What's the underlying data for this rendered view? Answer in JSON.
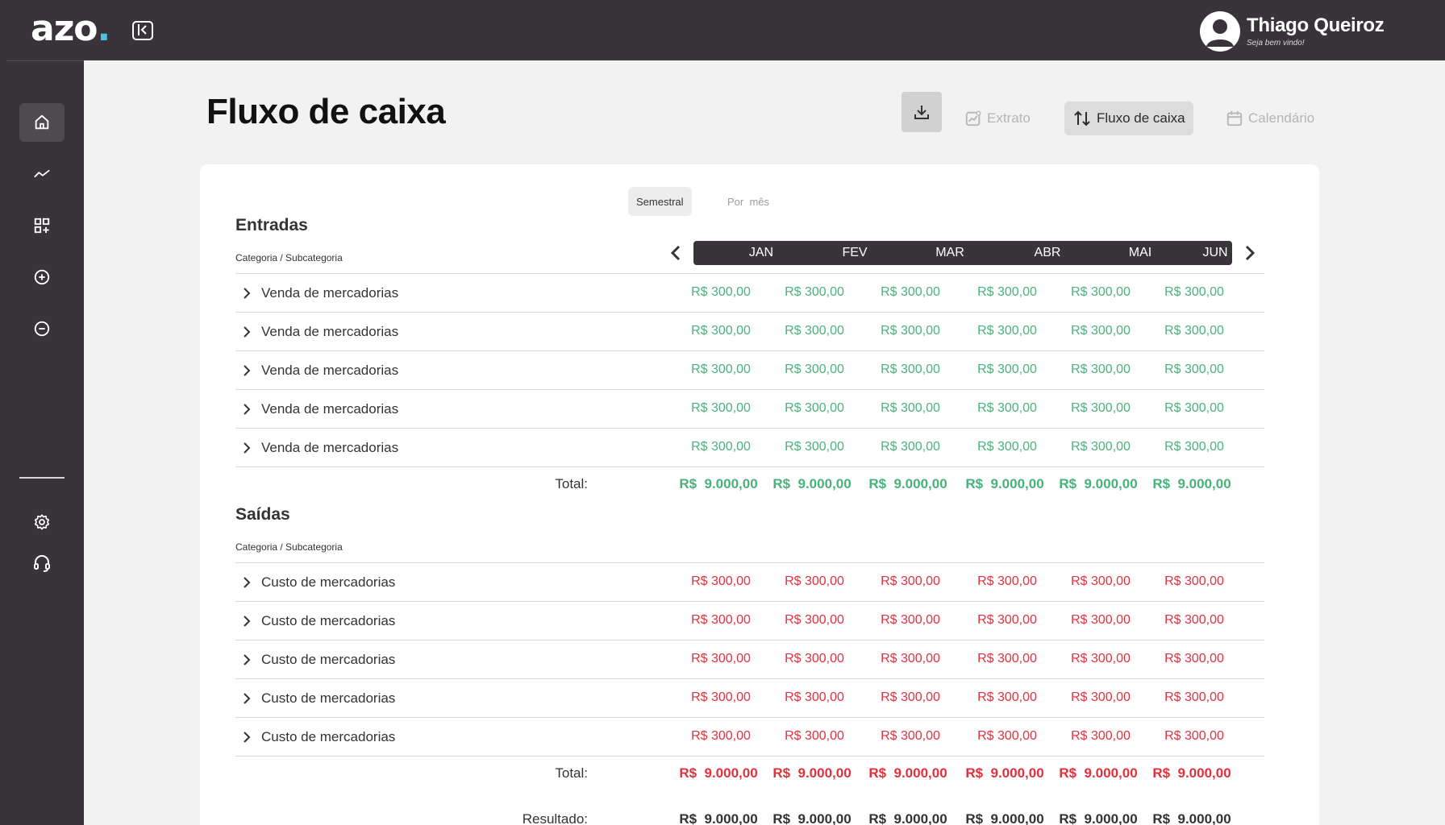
{
  "app": {
    "logo_text": "azo",
    "logo_dot": ".",
    "accent": "#4cc3e6"
  },
  "user": {
    "name": "Thiago Queiroz",
    "greeting": "Seja bem vindo!"
  },
  "page": {
    "title": "Fluxo de caixa"
  },
  "tabs": [
    {
      "label": "Extrato",
      "active": false
    },
    {
      "label": "Fluxo de caixa",
      "active": true
    },
    {
      "label": "Calendário",
      "active": false
    }
  ],
  "view_toggle": {
    "semestral": "Semestral",
    "por_mes": "Por  mês",
    "selected": "Semestral"
  },
  "months": [
    "JAN",
    "FEV",
    "MAR",
    "ABR",
    "MAI",
    "JUN"
  ],
  "entradas": {
    "title": "Entradas",
    "column_header": "Categoria / Subcategoria",
    "rows": [
      {
        "label": "Venda de mercadorias",
        "values": [
          "R$ 300,00",
          "R$ 300,00",
          "R$ 300,00",
          "R$ 300,00",
          "R$ 300,00",
          "R$ 300,00"
        ]
      },
      {
        "label": "Venda de mercadorias",
        "values": [
          "R$ 300,00",
          "R$ 300,00",
          "R$ 300,00",
          "R$ 300,00",
          "R$ 300,00",
          "R$ 300,00"
        ]
      },
      {
        "label": "Venda de mercadorias",
        "values": [
          "R$ 300,00",
          "R$ 300,00",
          "R$ 300,00",
          "R$ 300,00",
          "R$ 300,00",
          "R$ 300,00"
        ]
      },
      {
        "label": "Venda de mercadorias",
        "values": [
          "R$ 300,00",
          "R$ 300,00",
          "R$ 300,00",
          "R$ 300,00",
          "R$ 300,00",
          "R$ 300,00"
        ]
      },
      {
        "label": "Venda de mercadorias",
        "values": [
          "R$ 300,00",
          "R$ 300,00",
          "R$ 300,00",
          "R$ 300,00",
          "R$ 300,00",
          "R$ 300,00"
        ]
      }
    ],
    "total_label": "Total:",
    "totals": [
      "R$  9.000,00",
      "R$  9.000,00",
      "R$  9.000,00",
      "R$  9.000,00",
      "R$  9.000,00",
      "R$  9.000,00"
    ]
  },
  "saidas": {
    "title": "Saídas",
    "column_header": "Categoria / Subcategoria",
    "rows": [
      {
        "label": "Custo de mercadorias",
        "values": [
          "R$ 300,00",
          "R$ 300,00",
          "R$ 300,00",
          "R$ 300,00",
          "R$ 300,00",
          "R$ 300,00"
        ]
      },
      {
        "label": "Custo de mercadorias",
        "values": [
          "R$ 300,00",
          "R$ 300,00",
          "R$ 300,00",
          "R$ 300,00",
          "R$ 300,00",
          "R$ 300,00"
        ]
      },
      {
        "label": "Custo de mercadorias",
        "values": [
          "R$ 300,00",
          "R$ 300,00",
          "R$ 300,00",
          "R$ 300,00",
          "R$ 300,00",
          "R$ 300,00"
        ]
      },
      {
        "label": "Custo de mercadorias",
        "values": [
          "R$ 300,00",
          "R$ 300,00",
          "R$ 300,00",
          "R$ 300,00",
          "R$ 300,00",
          "R$ 300,00"
        ]
      },
      {
        "label": "Custo de mercadorias",
        "values": [
          "R$ 300,00",
          "R$ 300,00",
          "R$ 300,00",
          "R$ 300,00",
          "R$ 300,00",
          "R$ 300,00"
        ]
      }
    ],
    "total_label": "Total:",
    "totals": [
      "R$  9.000,00",
      "R$  9.000,00",
      "R$  9.000,00",
      "R$  9.000,00",
      "R$  9.000,00",
      "R$  9.000,00"
    ]
  },
  "resultado": {
    "label": "Resultado:",
    "values": [
      "R$  9.000,00",
      "R$  9.000,00",
      "R$  9.000,00",
      "R$  9.000,00",
      "R$  9.000,00",
      "R$  9.000,00"
    ]
  },
  "sidebar_icons": [
    "home-icon",
    "trend-icon",
    "apps-add-icon",
    "plus-circle-icon",
    "minus-circle-icon",
    "gear-icon",
    "headset-icon"
  ],
  "colors": {
    "income": "#49b27c",
    "expense": "#e2313d",
    "dark": "#38343a"
  }
}
